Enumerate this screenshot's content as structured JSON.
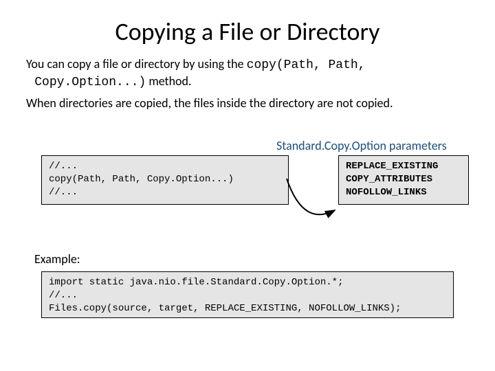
{
  "title": "Copying a File or Directory",
  "para1_a": "You can copy a file or directory by using the ",
  "para1_code1": "copy(Path, Path,",
  "para1_code2": "Copy.Option...)",
  "para1_b": " method.",
  "para2": "When directories are copied, the files inside the directory are not copied.",
  "options_label": "Standard.Copy.Option parameters",
  "code_left": "//...\ncopy(Path, Path, Copy.Option...)\n//...",
  "code_right": "REPLACE_EXISTING\nCOPY_ATTRIBUTES\nNOFOLLOW_LINKS",
  "example_label": "Example:",
  "code_bottom": "import static java.nio.file.Standard.Copy.Option.*;\n//...\nFiles.copy(source, target, REPLACE_EXISTING, NOFOLLOW_LINKS);"
}
